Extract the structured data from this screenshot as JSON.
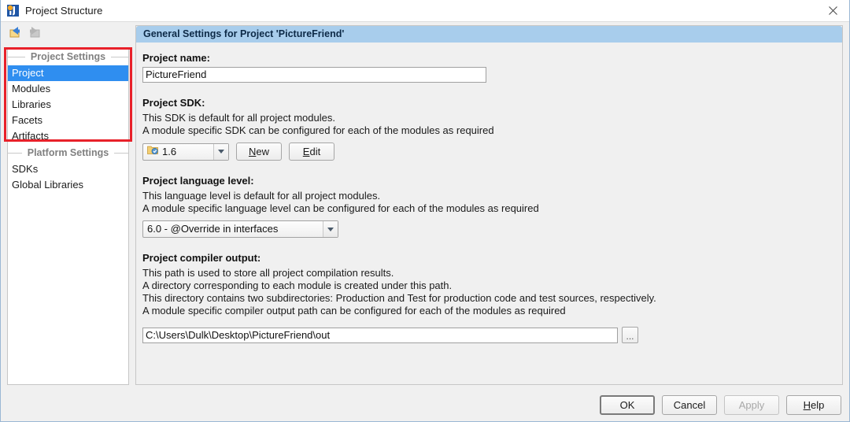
{
  "window": {
    "title": "Project Structure",
    "icon": "intellij-logo-icon",
    "close_label": "×"
  },
  "toolbar": {
    "back_icon": "back-arrow-icon",
    "forward_icon": "forward-arrow-icon"
  },
  "sidebar": {
    "groups": [
      {
        "label": "Project Settings",
        "items": [
          {
            "label": "Project",
            "selected": true
          },
          {
            "label": "Modules",
            "selected": false
          },
          {
            "label": "Libraries",
            "selected": false
          },
          {
            "label": "Facets",
            "selected": false
          },
          {
            "label": "Artifacts",
            "selected": false
          }
        ]
      },
      {
        "label": "Platform Settings",
        "items": [
          {
            "label": "SDKs",
            "selected": false
          },
          {
            "label": "Global Libraries",
            "selected": false
          }
        ]
      }
    ]
  },
  "annotation": {
    "color": "#e8212a",
    "target": "project-settings-group"
  },
  "main": {
    "header": "General Settings for Project 'PictureFriend'",
    "project_name": {
      "label": "Project name:",
      "value": "PictureFriend"
    },
    "project_sdk": {
      "label": "Project SDK:",
      "desc1": "This SDK is default for all project modules.",
      "desc2": "A module specific SDK can be configured for each of the modules as required",
      "value": "1.6",
      "sdk_icon": "sdk-folder-icon",
      "new_button": {
        "pre": "",
        "mnemonic": "N",
        "post": "ew"
      },
      "edit_button": {
        "pre": "",
        "mnemonic": "E",
        "post": "dit"
      }
    },
    "language_level": {
      "label": "Project language level:",
      "desc1": "This language level is default for all project modules.",
      "desc2": "A module specific language level can be configured for each of the modules as required",
      "value": "6.0 - @Override in interfaces"
    },
    "compiler_output": {
      "label": "Project compiler output:",
      "desc1": "This path is used to store all project compilation results.",
      "desc2": "A directory corresponding to each module is created under this path.",
      "desc3": "This directory contains two subdirectories: Production and Test for production code and test sources, respectively.",
      "desc4": "A module specific compiler output path can be configured for each of the modules as required",
      "value": "C:\\Users\\Dulk\\Desktop\\PictureFriend\\out",
      "browse_label": "..."
    }
  },
  "footer": {
    "ok": "OK",
    "cancel": "Cancel",
    "apply": "Apply",
    "help": {
      "pre": "",
      "mnemonic": "H",
      "post": "elp"
    }
  },
  "colors": {
    "selection_blue": "#2f8ef0",
    "header_blue": "#a8cdec",
    "annotation_red": "#e8212a",
    "window_bg": "#f0f0f0"
  }
}
